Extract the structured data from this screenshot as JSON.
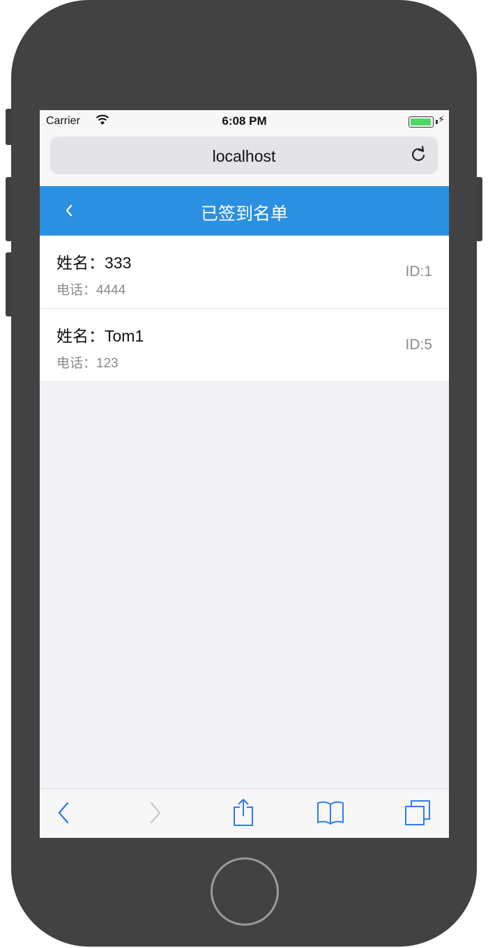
{
  "status_bar": {
    "carrier": "Carrier",
    "time": "6:08 PM"
  },
  "browser": {
    "url": "localhost"
  },
  "nav": {
    "title": "已签到名单"
  },
  "records": [
    {
      "name": "姓名：333",
      "phone": "电话：4444",
      "id": "ID:1"
    },
    {
      "name": "姓名：Tom1",
      "phone": "电话：123",
      "id": "ID:5"
    }
  ],
  "colors": {
    "accent": "#2b8fe2",
    "ios_blue": "#2f7cf6",
    "battery_green": "#4cd964"
  },
  "icons": {
    "wifi": "wifi-icon",
    "battery": "battery-icon",
    "reload": "reload-icon",
    "nav_back": "chevron-left-icon",
    "toolbar": [
      "back-arrow-icon",
      "forward-arrow-icon",
      "share-icon",
      "bookmarks-icon",
      "tabs-icon"
    ]
  }
}
